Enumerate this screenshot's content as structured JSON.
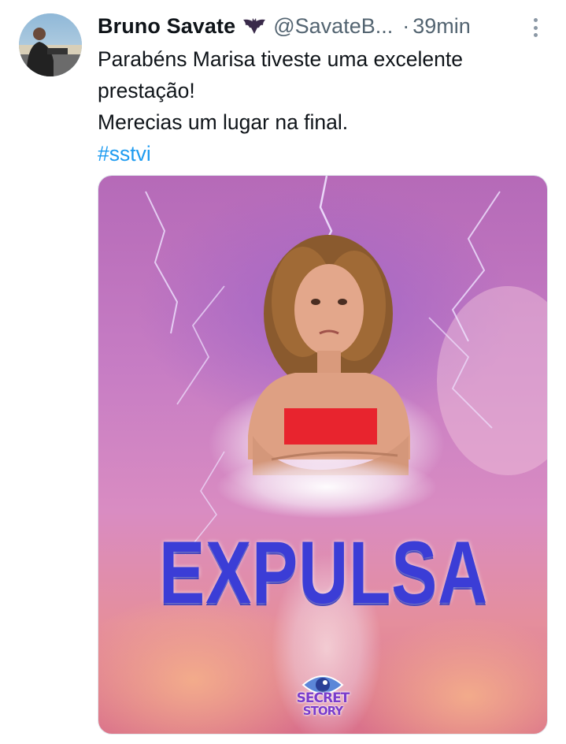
{
  "author": {
    "display_name": "Bruno Savate",
    "badge_icon": "bat-icon",
    "handle": "@SavateB...",
    "separator": "·",
    "timestamp": "39min"
  },
  "tweet": {
    "lines": [
      "Parabéns Marisa tiveste uma excelente",
      "prestação!",
      "Merecias um lugar na final."
    ],
    "hashtag": "#sstvi"
  },
  "media": {
    "headline": "EXPULSA",
    "logo": {
      "line1": "SECRET",
      "line2": "STORY"
    }
  },
  "colors": {
    "text": "#0f1419",
    "secondary": "#536471",
    "link": "#1d9bf0",
    "headline": "#3b3dd6"
  }
}
